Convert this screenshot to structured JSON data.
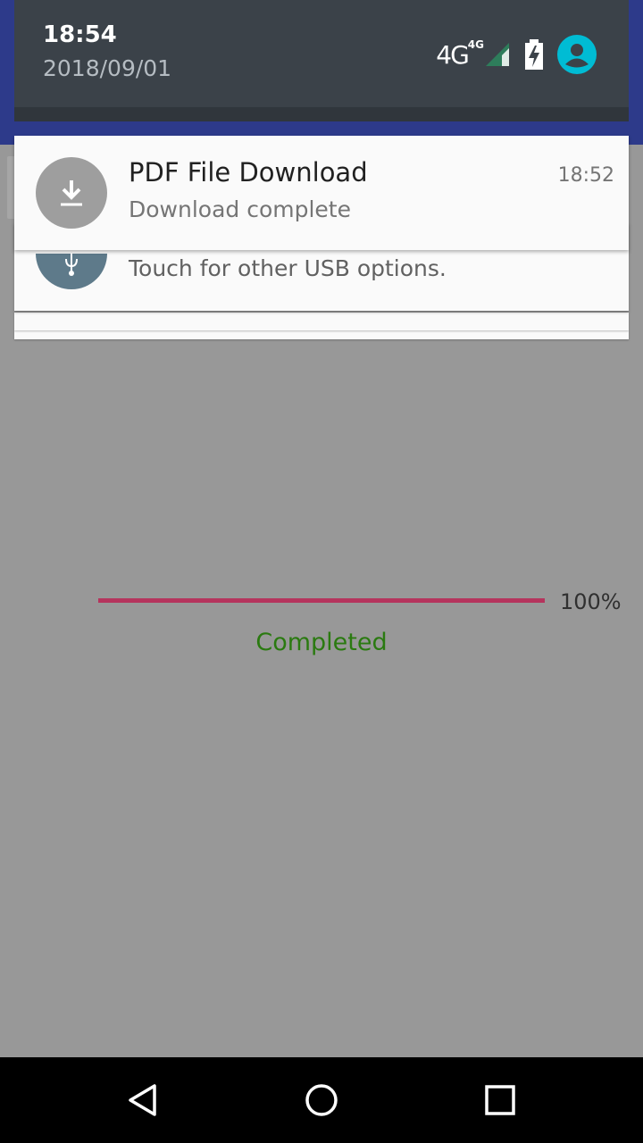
{
  "status_bar": {
    "time": "18:54",
    "date": "2018/09/01",
    "network_label": "4G",
    "network_sub": "4G",
    "icons": [
      "signal-icon",
      "battery-charging-icon",
      "account-icon"
    ],
    "avatar_color": "#00bcd4"
  },
  "notifications": [
    {
      "id": "download",
      "icon": "download-icon",
      "title": "PDF File Download",
      "text": "Download complete",
      "time": "18:52"
    },
    {
      "id": "usb",
      "icon": "usb-icon",
      "text": "Touch for other USB options."
    }
  ],
  "progress": {
    "value": 1.0,
    "percent_label": "100%",
    "status": "Completed",
    "fill_color": "#b5345d",
    "status_color": "#2a7a10"
  },
  "nav": {
    "buttons": [
      "back-icon",
      "home-icon",
      "recents-icon"
    ]
  }
}
